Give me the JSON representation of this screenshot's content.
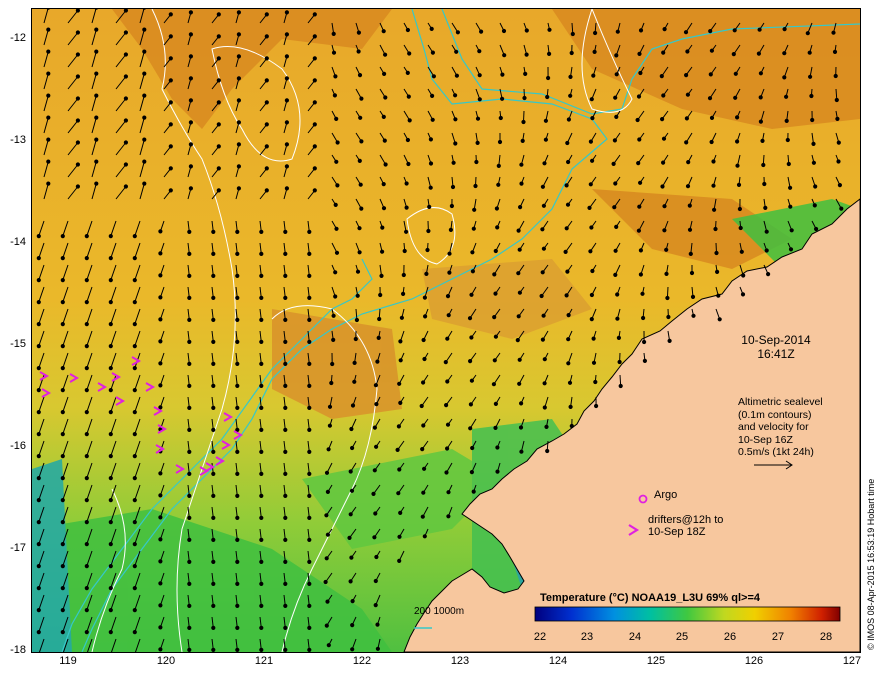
{
  "map": {
    "lat_ticks": [
      "-12",
      "-13",
      "-14",
      "-15",
      "-16",
      "-17",
      "-18"
    ],
    "lon_ticks": [
      "119",
      "120",
      "121",
      "122",
      "123",
      "124",
      "125",
      "126",
      "127"
    ],
    "lon_range": [
      118.6,
      127.0
    ],
    "lat_range": [
      -18.0,
      -11.8
    ]
  },
  "annotation": {
    "date": "10-Sep-2014",
    "time": "16:41Z",
    "altimetry_lines": [
      "Altimetric sealevel",
      "(0.1m contours)",
      "and velocity for",
      "10-Sep 16Z",
      "0.5m/s (1kt 24h)"
    ],
    "argo_label": "Argo",
    "drifter_lines": [
      "drifters@12h to",
      "10-Sep 18Z"
    ],
    "isobath_label": "200  1000m"
  },
  "colorbar": {
    "title": "Temperature (°C) NOAA19_L3U 69% ql>=4",
    "ticks": [
      "22",
      "23",
      "24",
      "25",
      "26",
      "27",
      "28"
    ],
    "range": [
      22,
      28.4
    ]
  },
  "credit": "© IMOS 08-Apr-2015 16:53:19 Hobart time",
  "colors": {
    "land": "#f7c79e",
    "isobath": "#36c8c8",
    "contour": "#ffffff",
    "drifter": "#e020e0",
    "warm_sst": "#d88a20",
    "mid_sst": "#e8c020",
    "cool_sst": "#40c040"
  },
  "icons": [
    "velocity-arrow-icon",
    "argo-float-icon",
    "drifter-chevron-icon"
  ]
}
